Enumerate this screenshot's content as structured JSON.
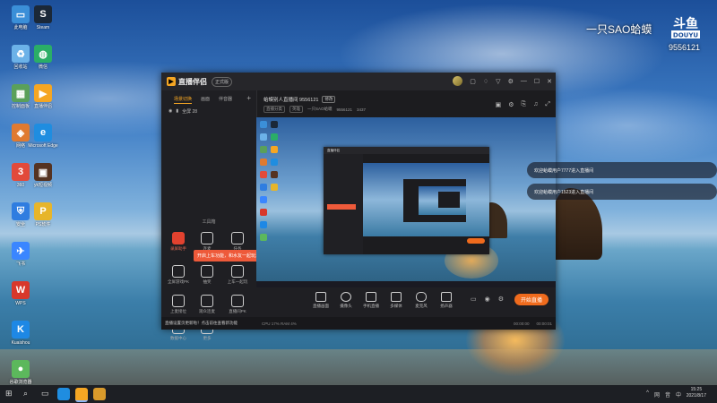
{
  "desktop": {
    "icons_col1": [
      {
        "label": "此电脑",
        "icon": "computer-icon",
        "color": "#3b8fd8"
      },
      {
        "label": "回收站",
        "icon": "recycle-bin-icon",
        "color": "#6cb2e8"
      },
      {
        "label": "控制面板",
        "icon": "control-panel-icon",
        "color": "#5aa05a"
      },
      {
        "label": "网络",
        "icon": "network-icon",
        "color": "#e07a30"
      },
      {
        "label": "360",
        "icon": "browser-icon",
        "color": "#e24a3a"
      },
      {
        "label": "安全",
        "icon": "shield-icon",
        "color": "#2f7de0"
      },
      {
        "label": "飞书",
        "icon": "feishu-icon",
        "color": "#3a86ff"
      },
      {
        "label": "WPS",
        "icon": "wps-icon",
        "color": "#d8382b"
      },
      {
        "label": "Kuaishou",
        "icon": "k-app-icon",
        "color": "#1e88e5"
      },
      {
        "label": "谷歌浏览器",
        "icon": "chrome-icon",
        "color": "#5cb85c"
      }
    ],
    "icons_col2": [
      {
        "label": "Steam",
        "icon": "steam-icon",
        "color": "#1b2838"
      },
      {
        "label": "微信",
        "icon": "wechat-icon",
        "color": "#2aae67"
      },
      {
        "label": "直播伴侣",
        "icon": "live-companion-icon",
        "color": "#f5a623"
      },
      {
        "label": "Microsoft Edge",
        "icon": "edge-icon",
        "color": "#1f8de0"
      },
      {
        "label": "yk短视频",
        "icon": "video-icon",
        "color": "#553322"
      },
      {
        "label": "PS软件",
        "icon": "ps-icon",
        "color": "#e7b52a"
      }
    ]
  },
  "watermark": {
    "name": "一只SAO蛤蟆",
    "logo_text": "斗鱼",
    "logo_sub": "DOUYU",
    "room_number": "9556121"
  },
  "app": {
    "title": "直播伴侣",
    "version_label": "正式版",
    "sidebar": {
      "tabs": [
        "场景切换",
        "画面",
        "伴音器"
      ],
      "scene_label": "全屏 28",
      "tools_title": "工具箱",
      "tools": [
        {
          "label": "录屏助手",
          "icon": "record-icon"
        },
        {
          "label": "连麦",
          "icon": "user-icon"
        },
        {
          "label": "任务",
          "icon": "task-icon"
        },
        {
          "label": "全屏游戏PK",
          "icon": "pk-icon"
        },
        {
          "label": "抽奖",
          "icon": "lottery-icon"
        },
        {
          "label": "上车一起玩",
          "icon": "car-icon"
        },
        {
          "label": "上麦接位",
          "icon": "mic-seat-icon"
        },
        {
          "label": "观众连麦",
          "icon": "audience-icon"
        },
        {
          "label": "直播间PK",
          "icon": "room-pk-icon"
        },
        {
          "label": "数据中心",
          "icon": "data-icon"
        },
        {
          "label": "更多",
          "icon": "more-icon"
        }
      ],
      "tooltip": "开启上车功能，和水友一起玩游戏~",
      "bottom_note": "直播设置页更新啦！点击前往查看新功能"
    },
    "room": {
      "title": "蛤蟆别人直播间 9556121",
      "edit_label": "修改",
      "category": "直播分类",
      "game": "英雄",
      "subtitle": "一只SAO蛤蟆",
      "room_id": "9556121",
      "viewers": "3437"
    },
    "controls": [
      {
        "label": "直播画面",
        "icon": "screen-icon"
      },
      {
        "label": "摄像头",
        "icon": "camera-icon"
      },
      {
        "label": "手机直播",
        "icon": "phone-icon"
      },
      {
        "label": "多媒体",
        "icon": "media-icon"
      },
      {
        "label": "麦克风",
        "icon": "mic-icon"
      },
      {
        "label": "扬声器",
        "icon": "speaker-icon"
      }
    ],
    "live_button": "开始直播",
    "status": {
      "fps": "CPU 17% RAM 4%",
      "time_live": "00:00:00",
      "time_rec": "00:00:01"
    }
  },
  "notifications": [
    {
      "text": "欢迎蛤蟆用户7777进入直播间"
    },
    {
      "text": "欢迎蛤蟆用户1523进入直播间"
    }
  ],
  "taskbar": {
    "time": "15:25",
    "date": "2021/8/17",
    "tray": [
      "^",
      "网",
      "音",
      "中"
    ]
  }
}
